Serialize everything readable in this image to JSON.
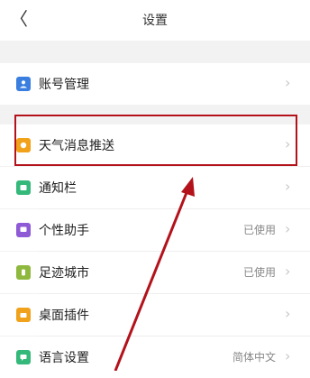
{
  "header": {
    "title": "设置",
    "back_glyph": "〈"
  },
  "sections": [
    {
      "items": [
        {
          "label": "账号管理",
          "value": "",
          "icon": "account-icon",
          "color": "#3a7fe0"
        }
      ]
    },
    {
      "items": [
        {
          "label": "天气消息推送",
          "value": "",
          "icon": "weather-push-icon",
          "color": "#f2a21a",
          "highlighted": true
        },
        {
          "label": "通知栏",
          "value": "",
          "icon": "notification-bar-icon",
          "color": "#35b97a"
        },
        {
          "label": "个性助手",
          "value": "已使用",
          "icon": "assistant-icon",
          "color": "#8e5ad6"
        },
        {
          "label": "足迹城市",
          "value": "已使用",
          "icon": "footprint-city-icon",
          "color": "#8fb93e"
        },
        {
          "label": "桌面插件",
          "value": "",
          "icon": "desktop-widget-icon",
          "color": "#f0a21c"
        },
        {
          "label": "语言设置",
          "value": "简体中文",
          "icon": "language-icon",
          "color": "#35b97a"
        }
      ]
    }
  ],
  "colors": {
    "highlight_border": "#b3121b",
    "arrow": "#b3121b"
  }
}
